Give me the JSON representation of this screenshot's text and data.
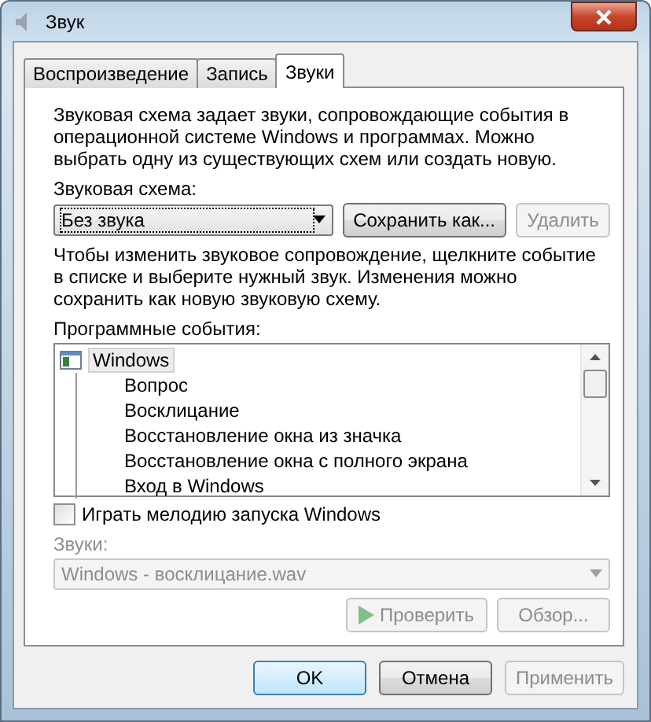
{
  "window": {
    "title": "Звук"
  },
  "tabs": [
    {
      "label": "Воспроизведение",
      "selected": false
    },
    {
      "label": "Запись",
      "selected": false
    },
    {
      "label": "Звуки",
      "selected": true
    }
  ],
  "description": "Звуковая схема задает звуки, сопровождающие события в операционной системе Windows и программах. Можно выбрать одну из существующих схем или создать новую.",
  "scheme": {
    "label": "Звуковая схема:",
    "value": "Без звука"
  },
  "scheme_buttons": [
    {
      "label": "Сохранить как...",
      "disabled": false
    },
    {
      "label": "Удалить",
      "disabled": true
    }
  ],
  "instructions": "Чтобы изменить звуковое сопровождение, щелкните  событие в списке и выберите нужный звук. Изменения можно сохранить как новую звуковую схему.",
  "events": {
    "label": "Программные события:",
    "items": [
      {
        "label": "Windows",
        "selected": true,
        "children": [
          {
            "label": "Вопрос",
            "selected": false
          },
          {
            "label": "Восклицание",
            "selected": false
          },
          {
            "label": "Восстановление окна из значка",
            "selected": false
          },
          {
            "label": "Восстановление окна с полного экрана",
            "selected": false
          },
          {
            "label": "Вход в Windows",
            "selected": false
          }
        ]
      }
    ]
  },
  "startup": {
    "label": "Играть мелодию запуска Windows",
    "checked": false
  },
  "sounds": {
    "label": "Звуки:",
    "value": "Windows - восклицание.wav",
    "disabled": true
  },
  "sound_buttons": [
    {
      "kind": "play",
      "label": "Проверить",
      "disabled": true
    },
    {
      "kind": "plain",
      "label": "Обзор...",
      "disabled": true
    }
  ],
  "dialog_buttons": [
    {
      "label": "OK",
      "kind": "default",
      "disabled": false
    },
    {
      "label": "Отмена",
      "kind": "plain",
      "disabled": false
    },
    {
      "label": "Применить",
      "kind": "plain",
      "disabled": true
    }
  ]
}
